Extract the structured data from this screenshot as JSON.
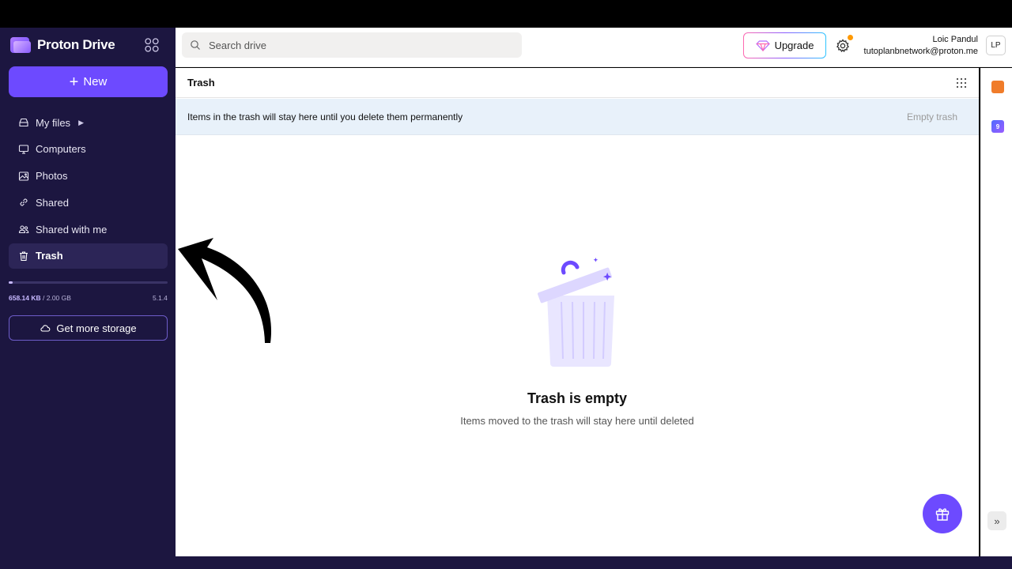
{
  "app": {
    "name": "Proton Drive"
  },
  "sidebar": {
    "new_label": "New",
    "items": [
      {
        "label": "My files",
        "icon": "hard-drive-icon"
      },
      {
        "label": "Computers",
        "icon": "monitor-icon"
      },
      {
        "label": "Photos",
        "icon": "image-icon"
      },
      {
        "label": "Shared",
        "icon": "link-icon"
      },
      {
        "label": "Shared with me",
        "icon": "users-icon"
      },
      {
        "label": "Trash",
        "icon": "trash-icon",
        "active": true
      }
    ],
    "storage": {
      "used": "658.14 KB",
      "total": "/ 2.00 GB",
      "used_fraction": 0.0003
    },
    "version": "5.1.4",
    "get_more_storage": "Get more storage"
  },
  "header": {
    "search_placeholder": "Search drive",
    "upgrade_label": "Upgrade",
    "user_name": "Loic Pandul",
    "user_email": "tutoplanbnetwork@proton.me",
    "avatar_initials": "LP"
  },
  "main": {
    "title": "Trash",
    "notice": "Items in the trash will stay here until you delete them permanently",
    "empty_trash_label": "Empty trash",
    "empty_title": "Trash is empty",
    "empty_subtitle": "Items moved to the trash will stay here until deleted"
  },
  "rightrail": {
    "calendar_day": "9"
  },
  "colors": {
    "brand": "#6d4aff",
    "sidebar_bg": "#1c1640",
    "notice_bg": "#e8f1fa"
  }
}
